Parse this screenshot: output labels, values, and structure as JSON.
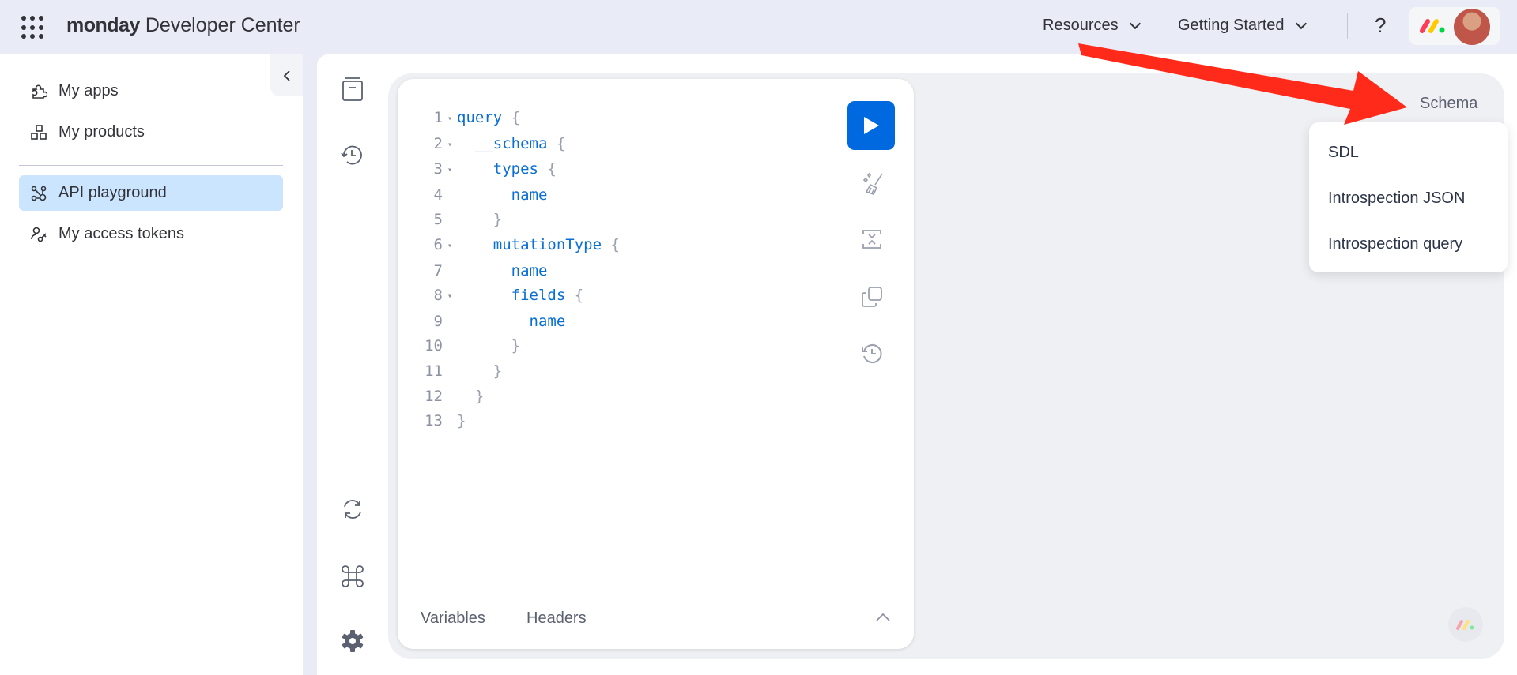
{
  "header": {
    "brand": "monday",
    "title": "Developer Center",
    "nav": [
      {
        "label": "Resources"
      },
      {
        "label": "Getting Started"
      }
    ],
    "help": "?"
  },
  "sidebar": {
    "items": [
      {
        "label": "My apps",
        "icon": "puzzle-icon"
      },
      {
        "label": "My products",
        "icon": "products-icon"
      },
      {
        "label": "API playground",
        "icon": "graph-icon",
        "active": true
      },
      {
        "label": "My access tokens",
        "icon": "tokens-icon"
      }
    ]
  },
  "editor": {
    "lines": [
      {
        "n": "1",
        "fold": "▾",
        "indent": "",
        "key": "query",
        "brace": " {"
      },
      {
        "n": "2",
        "fold": "▾",
        "indent": "  ",
        "key": "__schema",
        "brace": " {"
      },
      {
        "n": "3",
        "fold": "▾",
        "indent": "    ",
        "key": "types",
        "brace": " {"
      },
      {
        "n": "4",
        "fold": "",
        "indent": "      ",
        "key": "name",
        "brace": ""
      },
      {
        "n": "5",
        "fold": "",
        "indent": "    ",
        "key": "",
        "brace": "}"
      },
      {
        "n": "6",
        "fold": "▾",
        "indent": "    ",
        "key": "mutationType",
        "brace": " {"
      },
      {
        "n": "7",
        "fold": "",
        "indent": "      ",
        "key": "name",
        "brace": ""
      },
      {
        "n": "8",
        "fold": "▾",
        "indent": "      ",
        "key": "fields",
        "brace": " {"
      },
      {
        "n": "9",
        "fold": "",
        "indent": "        ",
        "key": "name",
        "brace": ""
      },
      {
        "n": "10",
        "fold": "",
        "indent": "      ",
        "key": "",
        "brace": "}"
      },
      {
        "n": "11",
        "fold": "",
        "indent": "    ",
        "key": "",
        "brace": "}"
      },
      {
        "n": "12",
        "fold": "",
        "indent": "  ",
        "key": "",
        "brace": "}"
      },
      {
        "n": "13",
        "fold": "",
        "indent": "",
        "key": "",
        "brace": "}"
      }
    ],
    "tabs": {
      "variables": "Variables",
      "headers": "Headers"
    }
  },
  "schema": {
    "label": "Schema",
    "menu": [
      "SDL",
      "Introspection JSON",
      "Introspection query"
    ]
  },
  "colors": {
    "accent": "#0069e0",
    "active": "#cce5ff",
    "arrow": "#ff2a1a"
  }
}
